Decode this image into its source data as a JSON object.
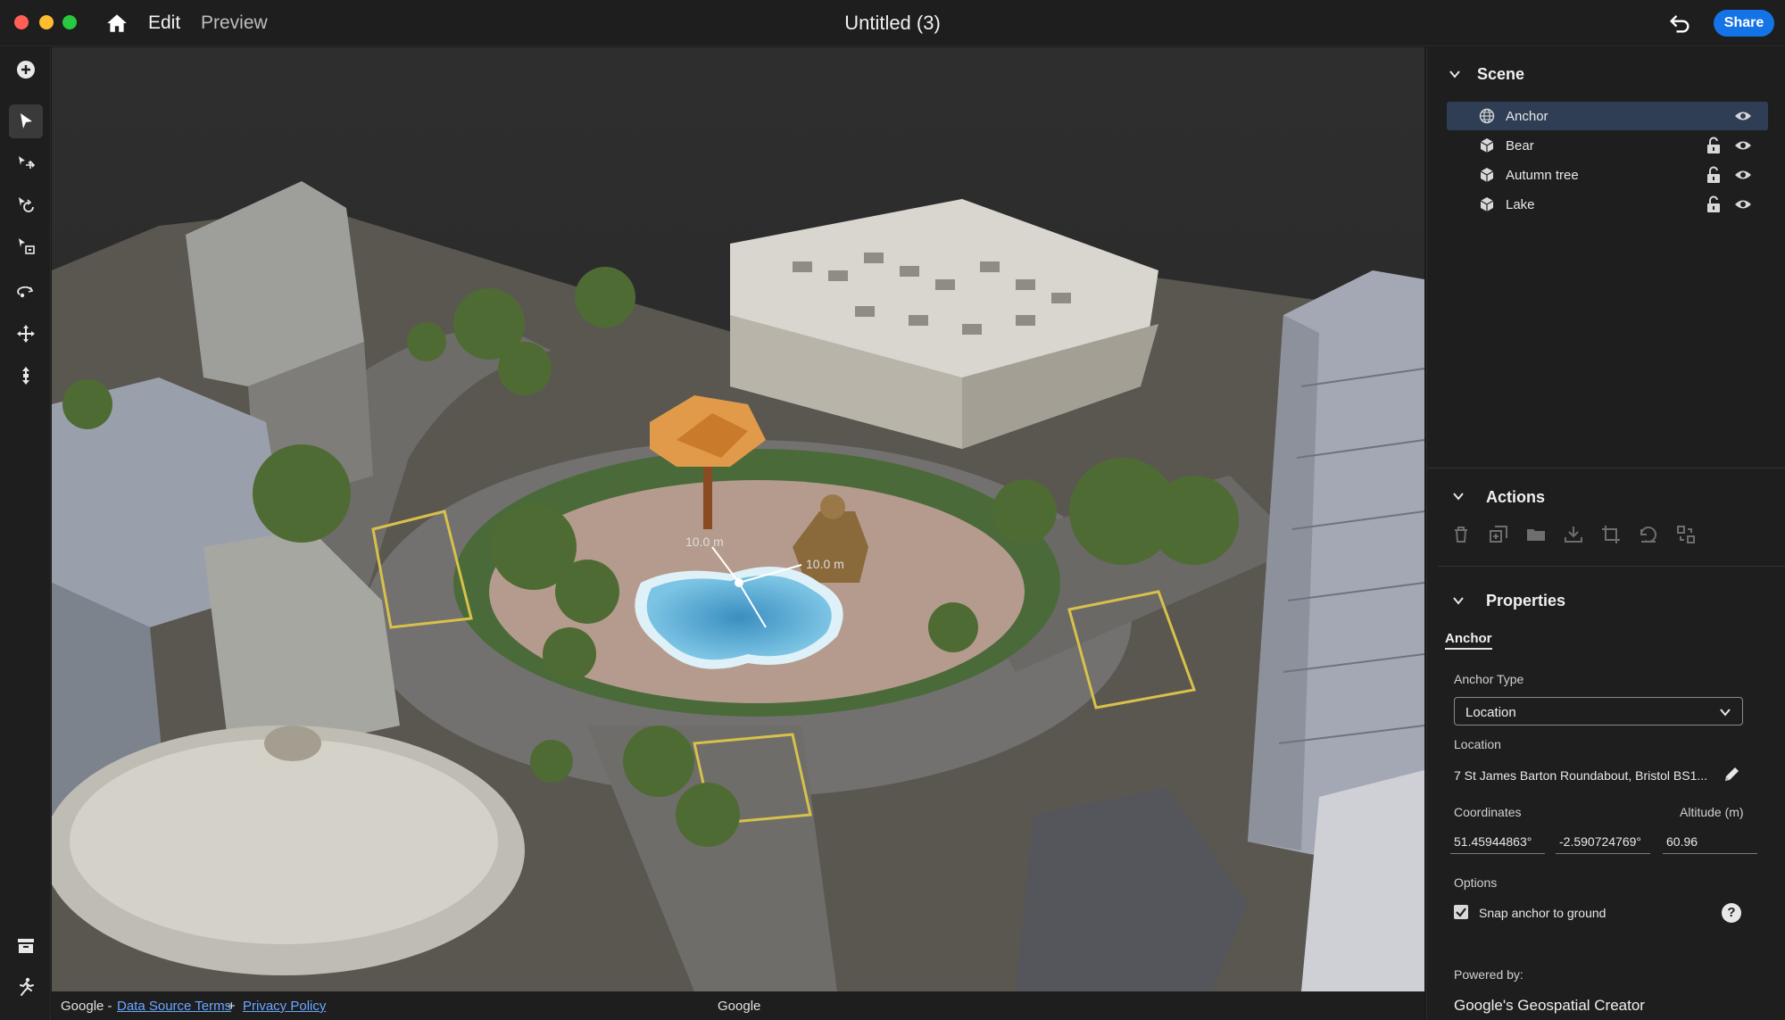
{
  "menu": {
    "edit": "Edit",
    "preview": "Preview"
  },
  "document": {
    "title": "Untitled (3)"
  },
  "header": {
    "share_label": "Share"
  },
  "footer": {
    "google_prefix": "Google -",
    "data_source_terms": "Data Source Terms",
    "plus": "+",
    "privacy_policy": "Privacy Policy",
    "attribution": "Google"
  },
  "viewport": {
    "gizmo_x_label": "10.0 m",
    "gizmo_z_label": "10.0 m"
  },
  "scene": {
    "title": "Scene",
    "items": [
      {
        "label": "Anchor",
        "icon": "globe-icon",
        "selected": true
      },
      {
        "label": "Bear",
        "icon": "cube-icon"
      },
      {
        "label": "Autumn tree",
        "icon": "cube-icon"
      },
      {
        "label": "Lake",
        "icon": "cube-icon"
      }
    ]
  },
  "actions": {
    "title": "Actions",
    "icons": [
      "trash-icon",
      "duplicate-icon",
      "folder-icon",
      "download-icon",
      "frame-icon",
      "reset-icon",
      "replace-icon"
    ]
  },
  "properties": {
    "title": "Properties",
    "object_name": "Anchor",
    "anchor_type_label": "Anchor Type",
    "anchor_type_value": "Location",
    "location_label": "Location",
    "location_value": "7 St James Barton Roundabout, Bristol BS1...",
    "coordinates_label": "Coordinates",
    "altitude_label": "Altitude (m)",
    "latitude": "51.45944863°",
    "longitude": "-2.590724769°",
    "altitude": "60.96",
    "options_label": "Options",
    "snap_label": "Snap anchor to ground",
    "snap_checked": true,
    "powered_by_label": "Powered by:",
    "powered_by_value": "Google's Geospatial Creator"
  },
  "colors": {
    "accent": "#1473e6",
    "selection": "#2f3d55",
    "panel_bg": "#1e1e1e"
  }
}
